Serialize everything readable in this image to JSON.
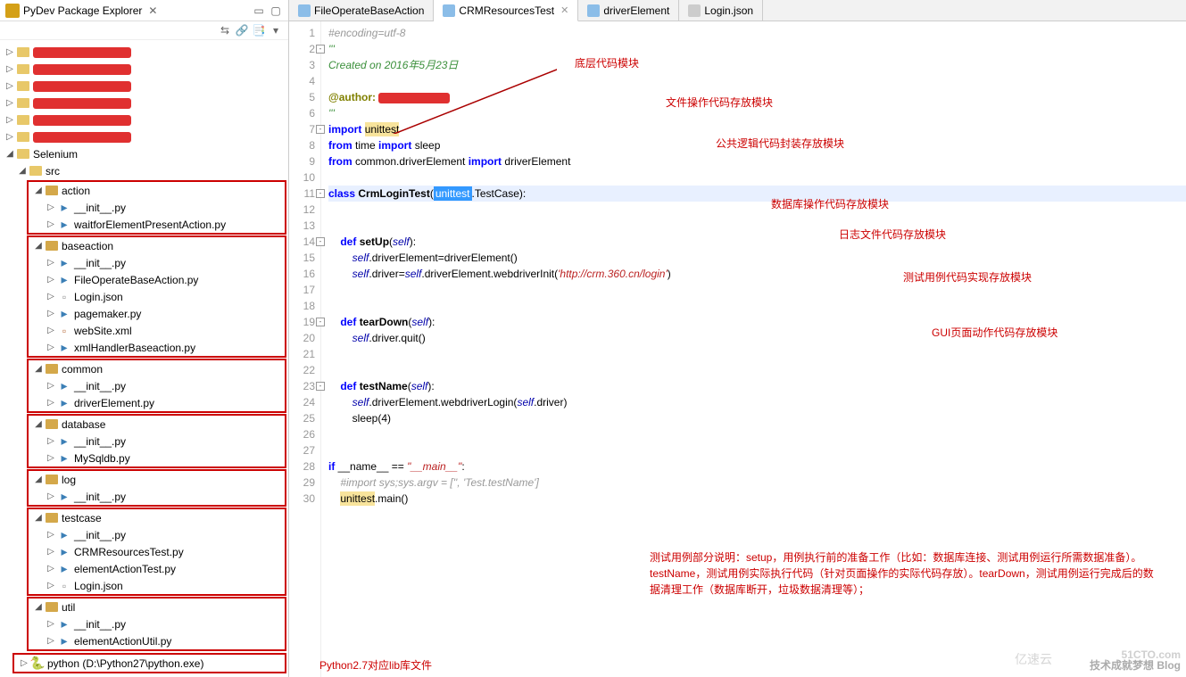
{
  "sidebar": {
    "title": "PyDev Package Explorer",
    "close_x": "✕",
    "tools": [
      "⇆",
      "⟲",
      "🔗",
      "▾"
    ],
    "redacted_count": 6,
    "selenium_label": "Selenium",
    "src_label": "src",
    "packages": [
      {
        "name": "action",
        "files": [
          "__init__.py",
          "waitforElementPresentAction.py"
        ]
      },
      {
        "name": "baseaction",
        "files": [
          "__init__.py",
          "FileOperateBaseAction.py",
          "Login.json",
          "pagemaker.py",
          "webSite.xml",
          "xmlHandlerBaseaction.py"
        ]
      },
      {
        "name": "common",
        "files": [
          "__init__.py",
          "driverElement.py"
        ]
      },
      {
        "name": "database",
        "files": [
          "__init__.py",
          "MySqldb.py"
        ]
      },
      {
        "name": "log",
        "files": [
          "__init__.py"
        ]
      },
      {
        "name": "testcase",
        "files": [
          "__init__.py",
          "CRMResourcesTest.py",
          "elementActionTest.py",
          "Login.json"
        ]
      },
      {
        "name": "util",
        "files": [
          "__init__.py",
          "elementActionUtil.py"
        ]
      }
    ],
    "python_interp": "python  (D:\\Python27\\python.exe)"
  },
  "tabs": [
    {
      "label": "FileOperateBaseAction",
      "icon": "py",
      "active": false
    },
    {
      "label": "CRMResourcesTest",
      "icon": "py",
      "active": true
    },
    {
      "label": "driverElement",
      "icon": "py",
      "active": false
    },
    {
      "label": "Login.json",
      "icon": "json",
      "active": false
    }
  ],
  "code": {
    "lines": [
      {
        "n": 1,
        "parts": [
          {
            "t": "#encoding=utf-8",
            "c": "c-cmt"
          }
        ]
      },
      {
        "n": 2,
        "parts": [
          {
            "t": "'''",
            "c": "c-doc"
          }
        ],
        "fold": true
      },
      {
        "n": 3,
        "parts": [
          {
            "t": "Created on 2016年5月23日",
            "c": "c-doc"
          }
        ]
      },
      {
        "n": 4,
        "parts": []
      },
      {
        "n": 5,
        "parts": [
          {
            "t": "@author:",
            "c": "c-dec"
          },
          {
            "t": " ",
            "c": "c-id"
          },
          {
            "t": "",
            "redact": true
          }
        ]
      },
      {
        "n": 6,
        "parts": [
          {
            "t": "'''",
            "c": "c-doc"
          }
        ]
      },
      {
        "n": 7,
        "parts": [
          {
            "t": "import",
            "c": "c-kw"
          },
          {
            "t": " ",
            "c": ""
          },
          {
            "t": "unittest",
            "c": "hl-y"
          }
        ],
        "fold": true
      },
      {
        "n": 8,
        "parts": [
          {
            "t": "from",
            "c": "c-kw"
          },
          {
            "t": " time ",
            "c": "c-id"
          },
          {
            "t": "import",
            "c": "c-kw"
          },
          {
            "t": " sleep",
            "c": "c-id"
          }
        ]
      },
      {
        "n": 9,
        "parts": [
          {
            "t": "from",
            "c": "c-kw"
          },
          {
            "t": " common.driverElement ",
            "c": "c-id"
          },
          {
            "t": "import",
            "c": "c-kw"
          },
          {
            "t": " driverElement",
            "c": "c-id"
          }
        ]
      },
      {
        "n": 10,
        "parts": []
      },
      {
        "n": 11,
        "parts": [
          {
            "t": "class",
            "c": "c-kw"
          },
          {
            "t": " ",
            "c": ""
          },
          {
            "t": "CrmLoginTest",
            "c": "c-fn"
          },
          {
            "t": "(",
            "c": "c-op"
          },
          {
            "t": "unittest",
            "c": "hl-sel"
          },
          {
            "t": ".TestCase):",
            "c": "c-id"
          }
        ],
        "fold": true,
        "hl": true
      },
      {
        "n": 12,
        "parts": []
      },
      {
        "n": 13,
        "parts": []
      },
      {
        "n": 14,
        "parts": [
          {
            "t": "    ",
            "c": ""
          },
          {
            "t": "def",
            "c": "c-kw"
          },
          {
            "t": " ",
            "c": ""
          },
          {
            "t": "setUp",
            "c": "c-fn"
          },
          {
            "t": "(",
            "c": "c-op"
          },
          {
            "t": "self",
            "c": "c-self"
          },
          {
            "t": "):",
            "c": "c-op"
          }
        ],
        "fold": true
      },
      {
        "n": 15,
        "parts": [
          {
            "t": "        ",
            "c": ""
          },
          {
            "t": "self",
            "c": "c-self"
          },
          {
            "t": ".driverElement=driverElement()",
            "c": "c-id"
          }
        ]
      },
      {
        "n": 16,
        "parts": [
          {
            "t": "        ",
            "c": ""
          },
          {
            "t": "self",
            "c": "c-self"
          },
          {
            "t": ".driver=",
            "c": "c-id"
          },
          {
            "t": "self",
            "c": "c-self"
          },
          {
            "t": ".driverElement.webdriverInit(",
            "c": "c-id"
          },
          {
            "t": "'http://crm.360.cn/login'",
            "c": "c-str"
          },
          {
            "t": ")",
            "c": "c-id"
          }
        ]
      },
      {
        "n": 17,
        "parts": []
      },
      {
        "n": 18,
        "parts": []
      },
      {
        "n": 19,
        "parts": [
          {
            "t": "    ",
            "c": ""
          },
          {
            "t": "def",
            "c": "c-kw"
          },
          {
            "t": " ",
            "c": ""
          },
          {
            "t": "tearDown",
            "c": "c-fn"
          },
          {
            "t": "(",
            "c": "c-op"
          },
          {
            "t": "self",
            "c": "c-self"
          },
          {
            "t": "):",
            "c": "c-op"
          }
        ],
        "fold": true
      },
      {
        "n": 20,
        "parts": [
          {
            "t": "        ",
            "c": ""
          },
          {
            "t": "self",
            "c": "c-self"
          },
          {
            "t": ".driver.quit()",
            "c": "c-id"
          }
        ]
      },
      {
        "n": 21,
        "parts": []
      },
      {
        "n": 22,
        "parts": []
      },
      {
        "n": 23,
        "parts": [
          {
            "t": "    ",
            "c": ""
          },
          {
            "t": "def",
            "c": "c-kw"
          },
          {
            "t": " ",
            "c": ""
          },
          {
            "t": "testName",
            "c": "c-fn"
          },
          {
            "t": "(",
            "c": "c-op"
          },
          {
            "t": "self",
            "c": "c-self"
          },
          {
            "t": "):",
            "c": "c-op"
          }
        ],
        "fold": true
      },
      {
        "n": 24,
        "parts": [
          {
            "t": "        ",
            "c": ""
          },
          {
            "t": "self",
            "c": "c-self"
          },
          {
            "t": ".driverElement.webdriverLogin(",
            "c": "c-id"
          },
          {
            "t": "self",
            "c": "c-self"
          },
          {
            "t": ".driver)",
            "c": "c-id"
          }
        ]
      },
      {
        "n": 25,
        "parts": [
          {
            "t": "        sleep(4)",
            "c": "c-id"
          }
        ]
      },
      {
        "n": 26,
        "parts": []
      },
      {
        "n": 27,
        "parts": []
      },
      {
        "n": 28,
        "parts": [
          {
            "t": "if",
            "c": "c-kw"
          },
          {
            "t": " __name__ == ",
            "c": "c-id"
          },
          {
            "t": "\"__main__\"",
            "c": "c-str"
          },
          {
            "t": ":",
            "c": "c-id"
          }
        ]
      },
      {
        "n": 29,
        "parts": [
          {
            "t": "    ",
            "c": ""
          },
          {
            "t": "#import sys;sys.argv = ['', 'Test.testName']",
            "c": "c-cmt"
          }
        ]
      },
      {
        "n": 30,
        "parts": [
          {
            "t": "    ",
            "c": ""
          },
          {
            "t": "unittest",
            "c": "hl-y"
          },
          {
            "t": ".main()",
            "c": "c-id"
          }
        ]
      }
    ]
  },
  "annotations": {
    "a1": "底层代码模块",
    "a2": "文件操作代码存放模块",
    "a3": "公共逻辑代码封装存放模块",
    "a4": "数据库操作代码存放模块",
    "a5": "日志文件代码存放模块",
    "a6": "测试用例代码实现存放模块",
    "a7": "GUI页面动作代码存放模块",
    "a8": "Python2.7对应lib库文件",
    "a9": "测试用例部分说明：setup，用例执行前的准备工作（比如：数据库连接、测试用例运行所需数据准备）。testName，测试用例实际执行代码（针对页面操作的实际代码存放）。tearDown，测试用例运行完成后的数据清理工作（数据库断开，垃圾数据清理等）；"
  },
  "watermark": {
    "brand": "51CTO.com",
    "sub": "技术成就梦想   Blog",
    "wm2": "亿速云"
  }
}
